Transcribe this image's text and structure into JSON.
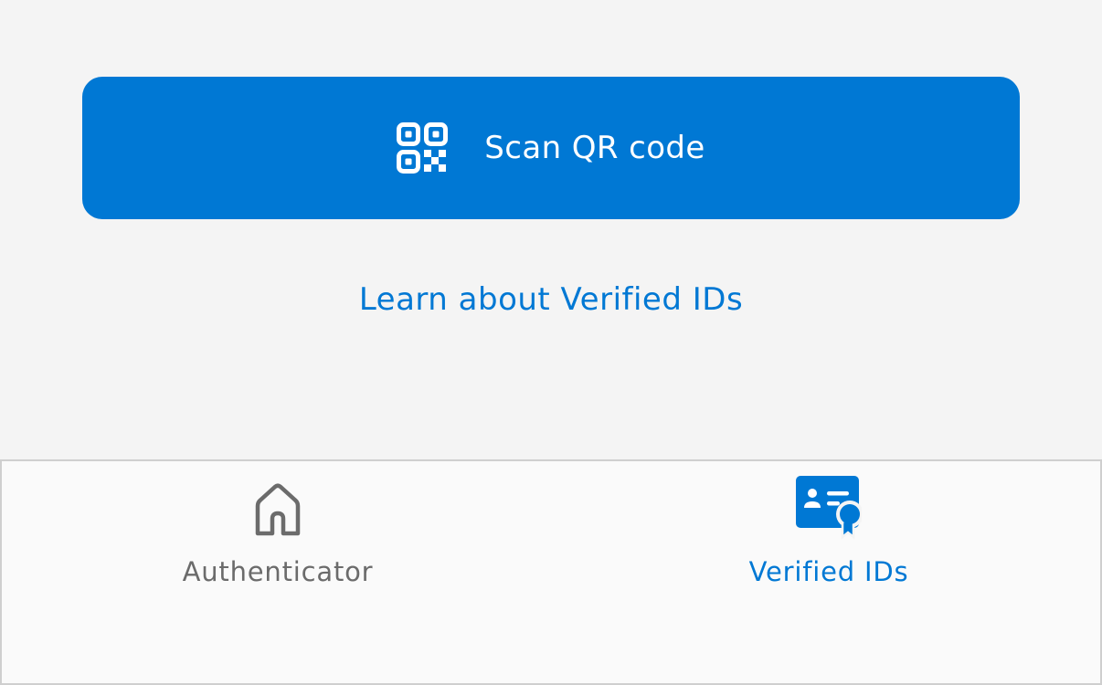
{
  "main": {
    "scan_button": {
      "label": "Scan QR code",
      "icon": "qr-code-icon"
    },
    "learn_link": {
      "label": "Learn about Verified IDs"
    }
  },
  "tab_bar": {
    "tabs": [
      {
        "label": "Authenticator",
        "icon": "home-icon",
        "selected": false
      },
      {
        "label": "Verified IDs",
        "icon": "verified-id-card-icon",
        "selected": true
      }
    ]
  },
  "colors": {
    "accent": "#0078d4",
    "background": "#f4f4f4",
    "tab_bar_background": "#fafafa",
    "inactive_tab": "#6b6b6b"
  }
}
